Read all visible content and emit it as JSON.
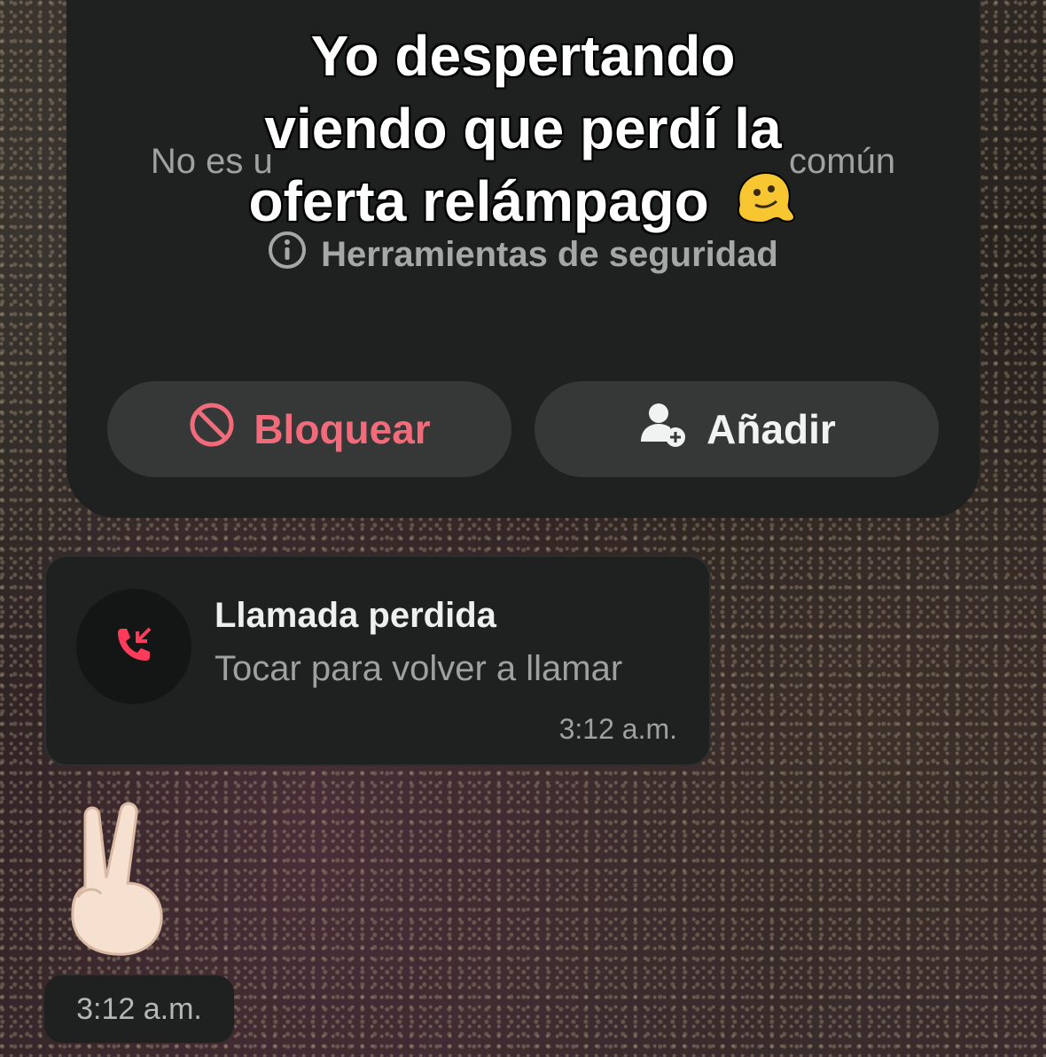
{
  "caption": {
    "line1": "Yo despertando",
    "line2": "viendo que perdí la",
    "line3": "oferta relámpago"
  },
  "contact_sheet": {
    "hidden_line": "No es un contacto · No hay grupos en común",
    "subtitle_left": "No es u",
    "subtitle_right": "común",
    "safety_tools": "Herramientas de seguridad",
    "block_label": "Bloquear",
    "add_label": "Añadir"
  },
  "missed_call": {
    "title": "Llamada perdida",
    "subtitle": "Tocar para volver a llamar",
    "time": "3:12 a.m."
  },
  "sticker_message": {
    "emoji": "✌🏻",
    "time": "3:12 a.m."
  },
  "colors": {
    "block_red": "#f26b7a",
    "call_red": "#ff3b5c",
    "sheet_bg": "#1f2120"
  },
  "icons": [
    "info-icon",
    "block-icon",
    "add-contact-icon",
    "missed-call-icon",
    "melting-face-emoji",
    "peace-hand-emoji"
  ]
}
